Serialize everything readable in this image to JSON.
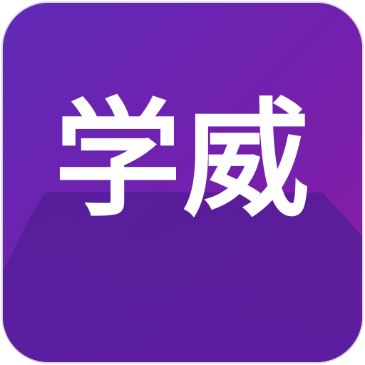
{
  "app_icon": {
    "label": "学威",
    "colors": {
      "gradient_start": "#6a27b8",
      "gradient_end": "#8a1ea6",
      "shadow": "#4e1b95",
      "text": "#ffffff",
      "border": "#d6d6d6"
    }
  }
}
